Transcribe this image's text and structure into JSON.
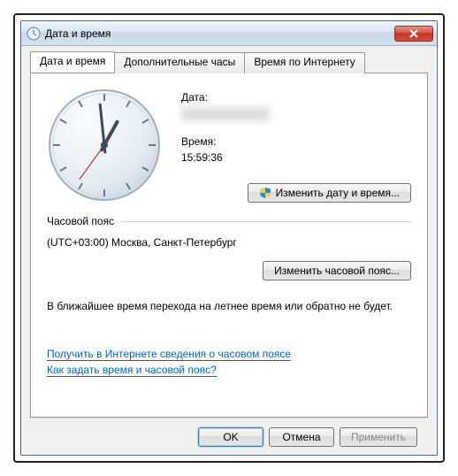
{
  "window": {
    "title": "Дата и время"
  },
  "tabs": [
    {
      "label": "Дата и время"
    },
    {
      "label": "Дополнительные часы"
    },
    {
      "label": "Время по Интернету"
    }
  ],
  "date": {
    "label": "Дата:"
  },
  "time": {
    "label": "Время:",
    "value": "15:59:36"
  },
  "buttons": {
    "change_datetime": "Изменить дату и время...",
    "change_timezone": "Изменить часовой пояс...",
    "ok": "OK",
    "cancel": "Отмена",
    "apply": "Применить"
  },
  "timezone": {
    "section_label": "Часовой пояс",
    "value": "(UTC+03:00) Москва, Санкт-Петербург"
  },
  "dst_notice": "В ближайшее время перехода на летнее время или обратно не будет.",
  "links": {
    "tz_info": "Получить в Интернете сведения о часовом поясе",
    "howto": "Как задать время и часовой пояс?"
  },
  "clock": {
    "hour_angle": 389,
    "minute_angle": 354,
    "second_angle": 216
  }
}
